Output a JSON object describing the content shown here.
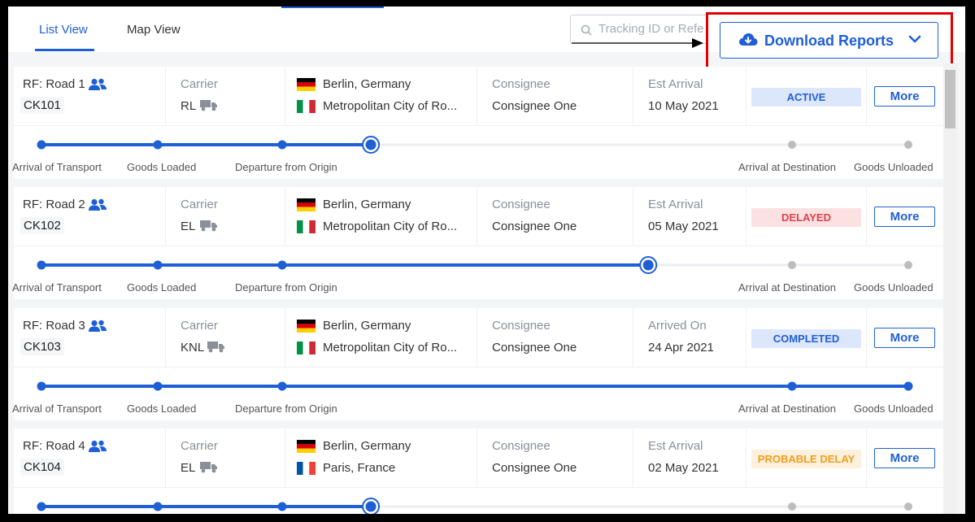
{
  "tabs": [
    {
      "label": "List View",
      "active": true
    },
    {
      "label": "Map View",
      "active": false
    }
  ],
  "search": {
    "placeholder": "Tracking ID or Refe"
  },
  "download": {
    "label": "Download Reports"
  },
  "stage_labels": [
    "Arrival of Transport",
    "Goods Loaded",
    "Departure from Origin",
    "Arrival at Destination",
    "Goods Unloaded"
  ],
  "shipments": [
    {
      "ref": "RF: Road 1",
      "id": "CK101",
      "carrier_label": "Carrier",
      "carrier": "RL",
      "origin": "Berlin, Germany",
      "origin_flag": "germany",
      "destination": "Metropolitan City of Ro...",
      "destination_flag": "italy",
      "consignee_label": "Consignee",
      "consignee": "Consignee One",
      "arrival_label": "Est Arrival",
      "arrival": "10 May 2021",
      "status": "ACTIVE",
      "status_color": "#1f5fd6",
      "status_bg": "#dde7fb",
      "more": "More",
      "progress": 0.38
    },
    {
      "ref": "RF: Road 2",
      "id": "CK102",
      "carrier_label": "Carrier",
      "carrier": "EL",
      "origin": "Berlin, Germany",
      "origin_flag": "germany",
      "destination": "Metropolitan City of Ro...",
      "destination_flag": "italy",
      "consignee_label": "Consignee",
      "consignee": "Consignee One",
      "arrival_label": "Est Arrival",
      "arrival": "05 May 2021",
      "status": "DELAYED",
      "status_color": "#e0404a",
      "status_bg": "#fbe1e2",
      "more": "More",
      "progress": 0.7
    },
    {
      "ref": "RF: Road 3",
      "id": "CK103",
      "carrier_label": "Carrier",
      "carrier": "KNL",
      "origin": "Berlin, Germany",
      "origin_flag": "germany",
      "destination": "Metropolitan City of Ro...",
      "destination_flag": "italy",
      "consignee_label": "Consignee",
      "consignee": "Consignee One",
      "arrival_label": "Arrived On",
      "arrival": "24 Apr 2021",
      "status": "COMPLETED",
      "status_color": "#1f5fd6",
      "status_bg": "#dde7fb",
      "more": "More",
      "progress": 1.0
    },
    {
      "ref": "RF: Road 4",
      "id": "CK104",
      "carrier_label": "Carrier",
      "carrier": "EL",
      "origin": "Berlin, Germany",
      "origin_flag": "germany",
      "destination": "Paris, France",
      "destination_flag": "france",
      "consignee_label": "Consignee",
      "consignee": "Consignee One",
      "arrival_label": "Est Arrival",
      "arrival": "02 May 2021",
      "status": "PROBABLE DELAY",
      "status_color": "#f29d1a",
      "status_bg": "#fdf0dc",
      "more": "More",
      "progress": 0.38
    }
  ],
  "colors": {
    "accent": "#1f5fd6",
    "highlight": "#e00000",
    "inactive": "#bdbdbd"
  }
}
